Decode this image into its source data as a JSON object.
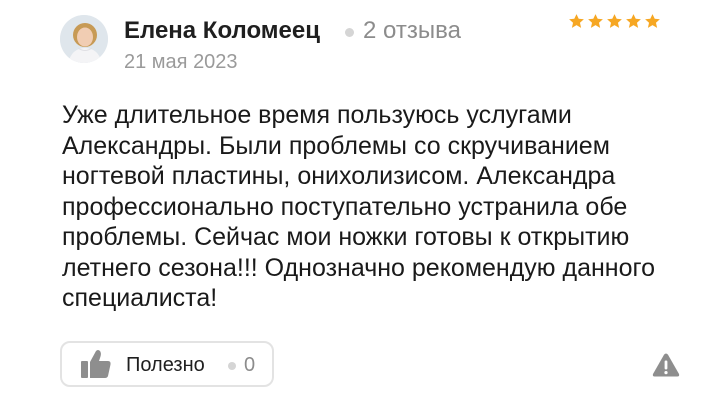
{
  "author": {
    "name": "Елена Коломеец",
    "reviews_count": "2 отзыва",
    "avatar_icon": "user-avatar"
  },
  "review": {
    "date": "21 мая 2023",
    "rating": 5,
    "rating_max": 5,
    "star_color": "#f6a723",
    "text": "Уже длительное время пользуюсь услугами Александры. Были проблемы со скручиванием ногтевой пластины, онихолизисом. Александра профессионально поступательно устранила обе проблемы. Сейчас мои ножки готовы к открытию летнего сезона!!! Однозначно рекомендую данного специалиста!"
  },
  "actions": {
    "helpful_label": "Полезно",
    "helpful_count": "0",
    "helpful_icon": "thumbs-up-icon",
    "report_icon": "warning-icon"
  }
}
